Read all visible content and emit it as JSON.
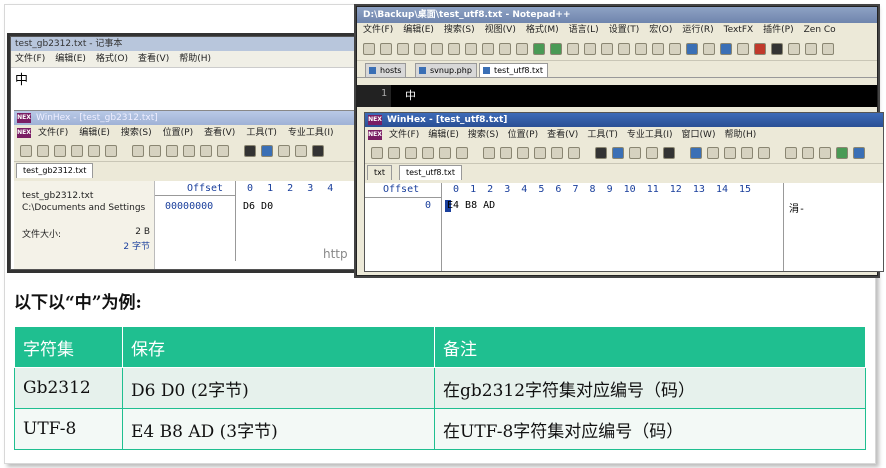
{
  "notepad_gb": {
    "title": "test_gb2312.txt - 记事本",
    "menu": [
      "文件(F)",
      "编辑(E)",
      "格式(O)",
      "查看(V)",
      "帮助(H)"
    ],
    "content": "中"
  },
  "winhex_gb": {
    "title": "WinHex - [test_gb2312.txt]",
    "menu": [
      "文件(F)",
      "编辑(E)",
      "搜索(S)",
      "位置(P)",
      "查看(V)",
      "工具(T)",
      "专业工具(I)"
    ],
    "tab": "test_gb2312.txt",
    "file_name": "test_gb2312.txt",
    "file_path": "C:\\Documents and Settings",
    "size_label": "文件大小:",
    "size_bytes": "2 B",
    "size_chars": "2 字节",
    "offset_header": "Offset",
    "columns": [
      "0",
      "1",
      "2",
      "3",
      "4"
    ],
    "offset_value": "00000000",
    "hex_value": "D6 D0",
    "watermark": "http"
  },
  "notepadpp": {
    "title": "D:\\Backup\\桌面\\test_utf8.txt - Notepad++",
    "menu": [
      "文件(F)",
      "编辑(E)",
      "搜索(S)",
      "视图(V)",
      "格式(M)",
      "语言(L)",
      "设置(T)",
      "宏(O)",
      "运行(R)",
      "TextFX",
      "插件(P)",
      "Zen Co"
    ],
    "tabs": [
      "hosts",
      "svnup.php",
      "test_utf8.txt"
    ],
    "line_number": "1",
    "line_content": "中"
  },
  "winhex_utf8": {
    "title": "WinHex - [test_utf8.txt]",
    "menu": [
      "文件(F)",
      "编辑(E)",
      "搜索(S)",
      "位置(P)",
      "查看(V)",
      "工具(T)",
      "专业工具(I)",
      "窗口(W)",
      "帮助(H)"
    ],
    "tabs": [
      "txt",
      "test_utf8.txt"
    ],
    "offset_header": "Offset",
    "columns": [
      "0",
      "1",
      "2",
      "3",
      "4",
      "5",
      "6",
      "7",
      "8",
      "9",
      "10",
      "11",
      "12",
      "13",
      "14",
      "15"
    ],
    "offset_value": "0",
    "hex_value": "E4 B8 AD",
    "ascii_value": "涓-"
  },
  "caption": "以下以“中”为例:",
  "table": {
    "headers": [
      "字符集",
      "保存",
      "备注"
    ],
    "rows": [
      [
        "Gb2312",
        "D6 D0  (2字节)",
        "在gb2312字符集对应编号（码）"
      ],
      [
        "UTF-8",
        "E4 B8 AD  (3字节)",
        "在UTF-8字符集对应编号（码）"
      ]
    ]
  },
  "colors": {
    "table_header": "#1fbf90",
    "table_border": "#1fbf90"
  }
}
